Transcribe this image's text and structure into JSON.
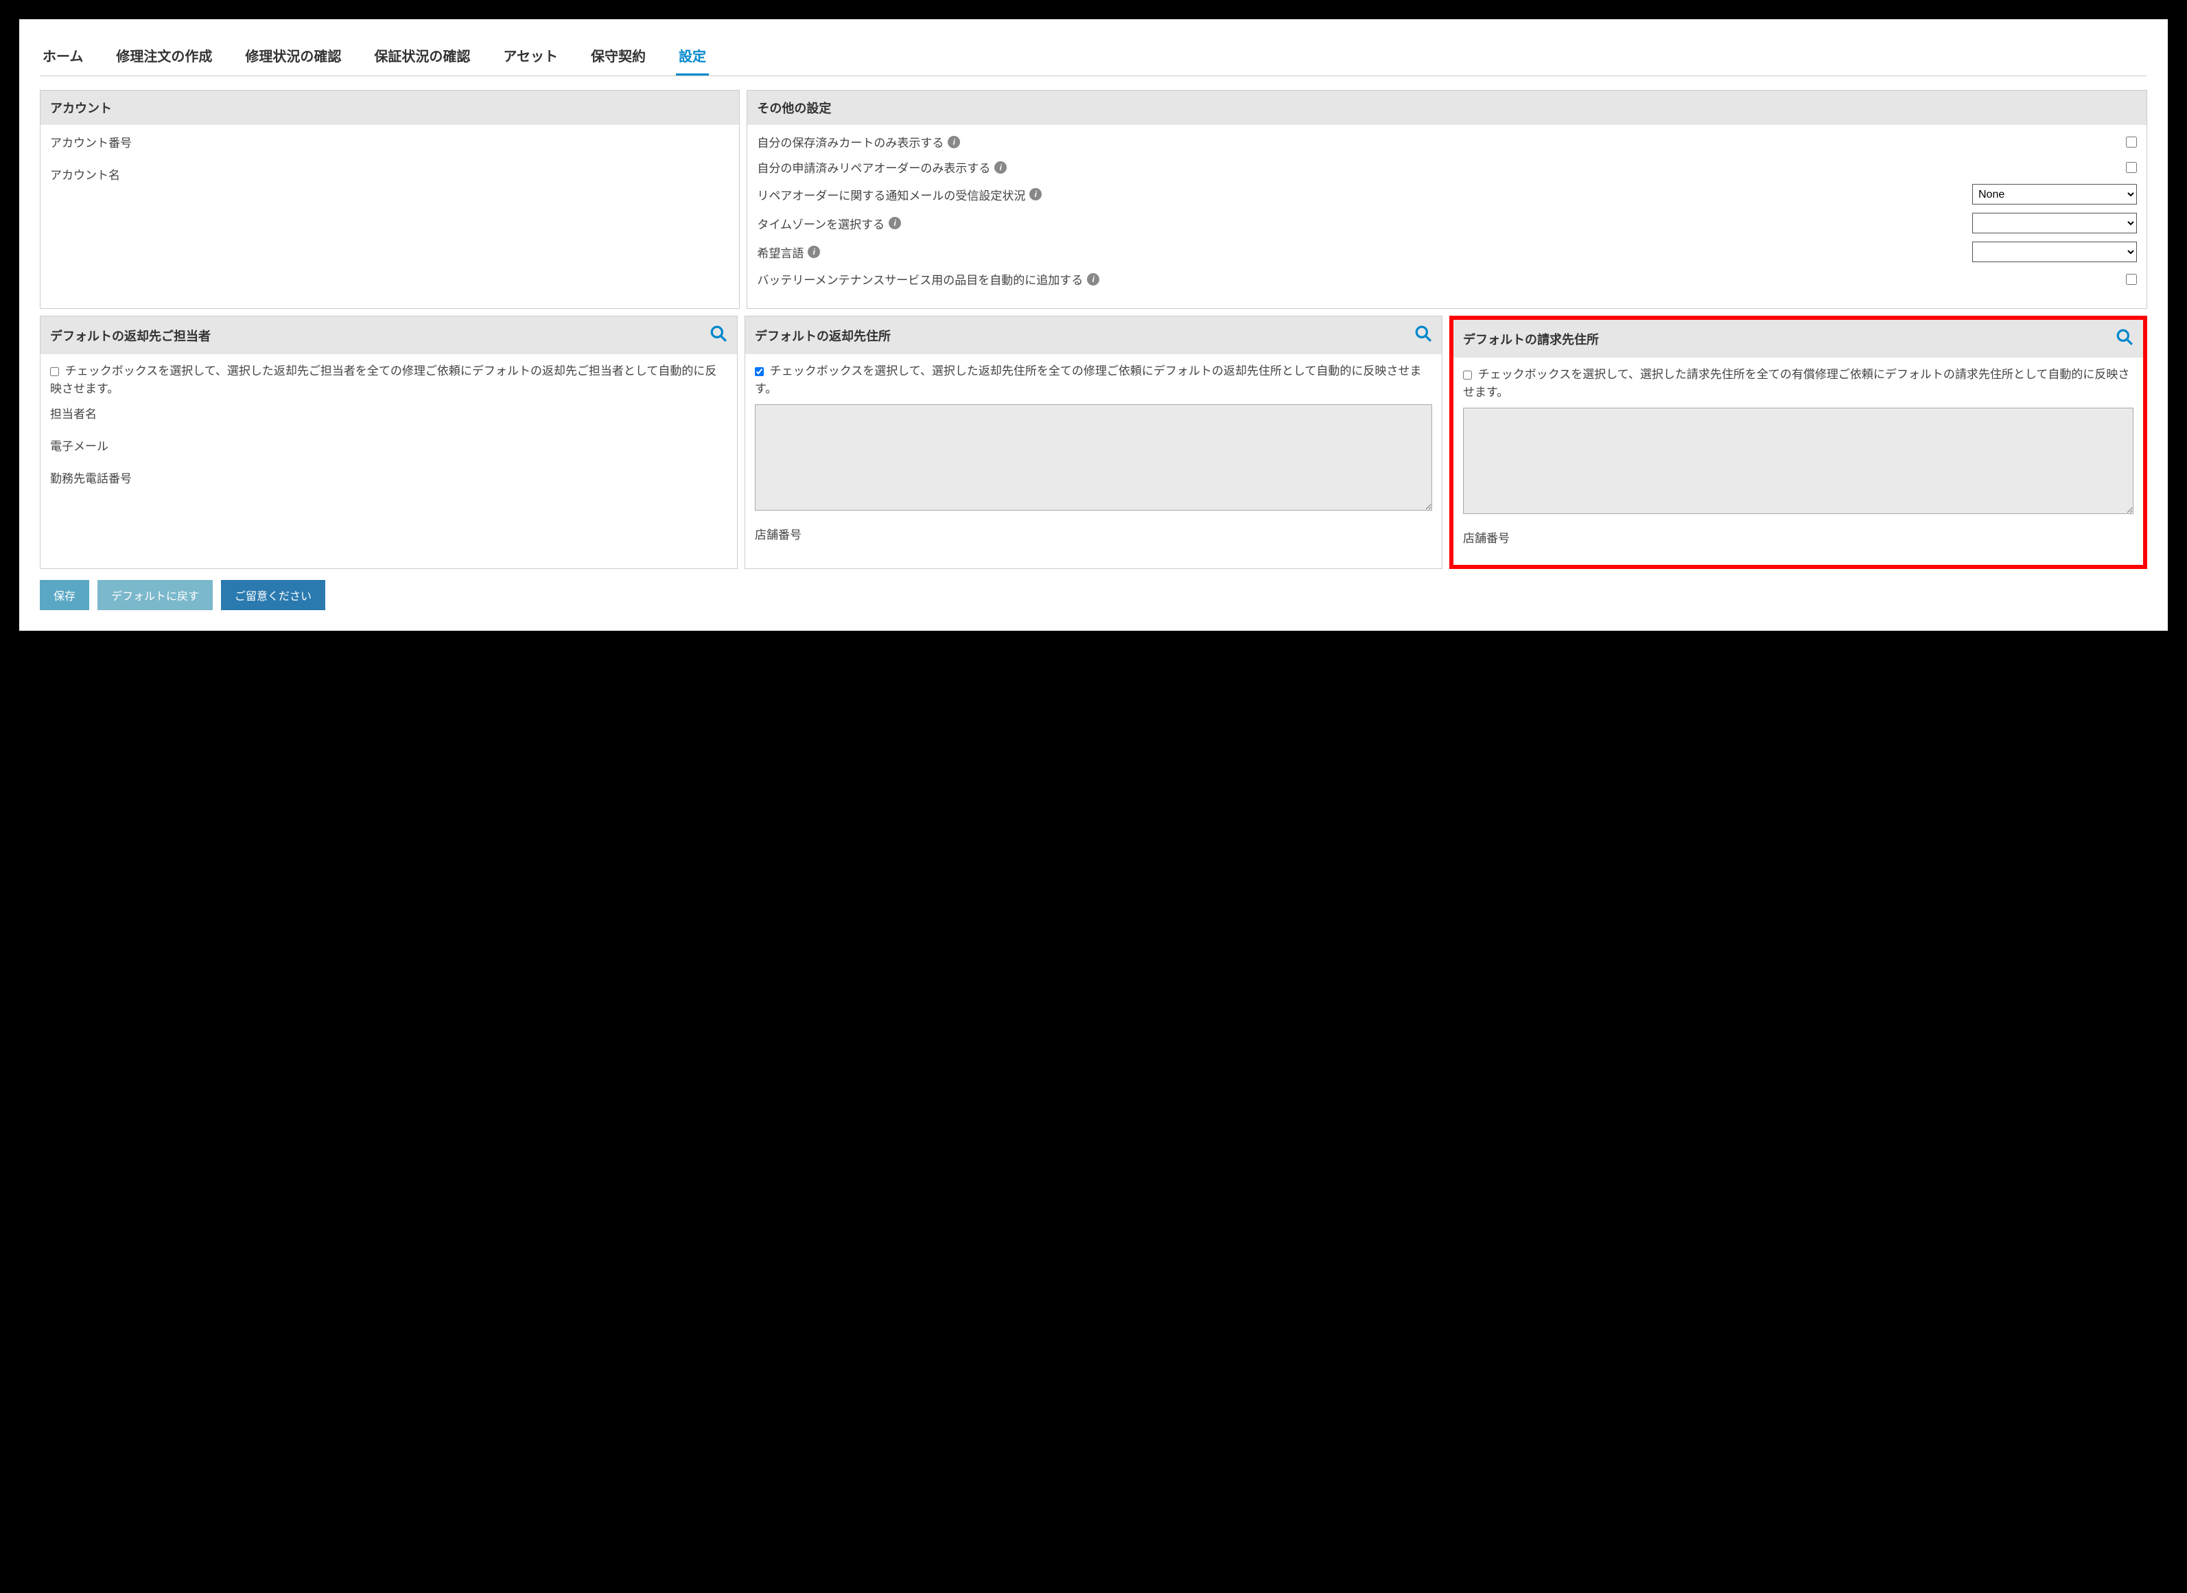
{
  "tabs": {
    "home": "ホーム",
    "createOrder": "修理注文の作成",
    "checkRepair": "修理状況の確認",
    "checkWarranty": "保証状況の確認",
    "asset": "アセット",
    "maintenance": "保守契約",
    "settings": "設定"
  },
  "account": {
    "title": "アカウント",
    "number_label": "アカウント番号",
    "name_label": "アカウント名"
  },
  "other": {
    "title": "その他の設定",
    "showOwnCarts": "自分の保存済みカートのみ表示する",
    "showOwnOrders": "自分の申請済みリペアオーダーのみ表示する",
    "mailStatus": "リペアオーダーに関する通知メールの受信設定状況",
    "mailSelected": "None",
    "timezone": "タイムゾーンを選択する",
    "timezoneSelected": "",
    "language": "希望言語",
    "languageSelected": "",
    "battery": "バッテリーメンテナンスサービス用の品目を自動的に追加する"
  },
  "returnContact": {
    "title": "デフォルトの返却先ご担当者",
    "cbText": "チェックボックスを選択して、選択した返却先ご担当者を全ての修理ご依頼にデフォルトの返却先ご担当者として自動的に反映させます。",
    "name": "担当者名",
    "email": "電子メール",
    "phone": "勤務先電話番号"
  },
  "returnAddr": {
    "title": "デフォルトの返却先住所",
    "cbText": "チェックボックスを選択して、選択した返却先住所を全ての修理ご依頼にデフォルトの返却先住所として自動的に反映させます。",
    "store": "店舗番号"
  },
  "billAddr": {
    "title": "デフォルトの請求先住所",
    "cbText": "チェックボックスを選択して、選択した請求先住所を全ての有償修理ご依頼にデフォルトの請求先住所として自動的に反映させます。",
    "store": "店舗番号"
  },
  "buttons": {
    "save": "保存",
    "reset": "デフォルトに戻す",
    "note": "ご留意ください"
  }
}
